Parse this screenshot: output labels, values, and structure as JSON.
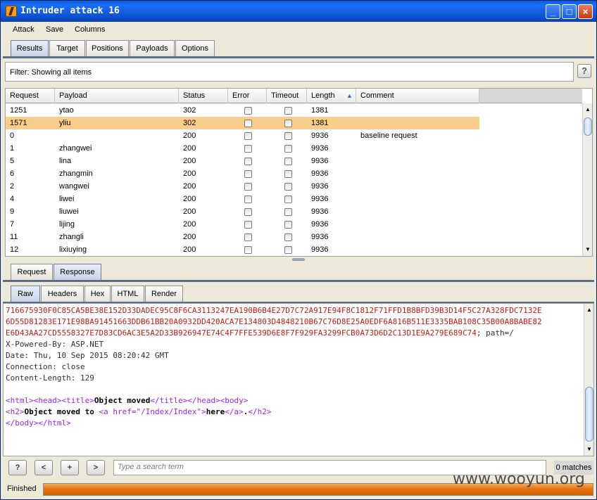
{
  "window": {
    "title": "Intruder attack 16"
  },
  "title_buttons": {
    "minimize": "_",
    "maximize": "□",
    "close": "×"
  },
  "menu": [
    "Attack",
    "Save",
    "Columns"
  ],
  "tabs": [
    "Results",
    "Target",
    "Positions",
    "Payloads",
    "Options"
  ],
  "filter": {
    "text": "Filter:  Showing all items",
    "help": "?"
  },
  "table": {
    "headers": [
      "Request",
      "Payload",
      "Status",
      "Error",
      "Timeout",
      "Length",
      "Comment"
    ],
    "sort_indicator": "▲",
    "rows": [
      {
        "request": "1251",
        "payload": "ytao",
        "status": "302",
        "length": "1381",
        "comment": ""
      },
      {
        "request": "1571",
        "payload": "yliu",
        "status": "302",
        "length": "1381",
        "comment": ""
      },
      {
        "request": "0",
        "payload": "",
        "status": "200",
        "length": "9936",
        "comment": "baseline request"
      },
      {
        "request": "1",
        "payload": "zhangwei",
        "status": "200",
        "length": "9936",
        "comment": ""
      },
      {
        "request": "5",
        "payload": "lina",
        "status": "200",
        "length": "9936",
        "comment": ""
      },
      {
        "request": "6",
        "payload": "zhangmin",
        "status": "200",
        "length": "9936",
        "comment": ""
      },
      {
        "request": "2",
        "payload": "wangwei",
        "status": "200",
        "length": "9936",
        "comment": ""
      },
      {
        "request": "4",
        "payload": "liwei",
        "status": "200",
        "length": "9936",
        "comment": ""
      },
      {
        "request": "9",
        "payload": "liuwei",
        "status": "200",
        "length": "9936",
        "comment": ""
      },
      {
        "request": "7",
        "payload": "lijing",
        "status": "200",
        "length": "9936",
        "comment": ""
      },
      {
        "request": "11",
        "payload": "zhangli",
        "status": "200",
        "length": "9936",
        "comment": ""
      },
      {
        "request": "12",
        "payload": "lixiuying",
        "status": "200",
        "length": "9936",
        "comment": ""
      }
    ]
  },
  "detail_tabs": [
    "Request",
    "Response"
  ],
  "view_tabs": [
    "Raw",
    "Headers",
    "Hex",
    "HTML",
    "Render"
  ],
  "response": {
    "cookie_lines": [
      "716675930F0C85CA5BE38E152D33DADEC95C8F6CA3113247EA190B6B4E27D7C72A917E94F8C1812F71FFD1B8BFD39B3D14F5C27A328FDC7132E",
      "6D55D81283E171E98BA91451663DDB61BB20A0932DD420ACA7E134803D4848210B67C76D8E25A0EDF6A816B511E3335BAB108C35B00A8BABE82",
      "E6D43AA27CD5558327E7D83CD6AC3E5A2D33B926947E74C4F7FFE539D6E8F7F929FA3299FCB0A73D6D2C13D1E9A279E689C74"
    ],
    "cookie_suffix": "; path=/",
    "headers": [
      "X-Powered-By: ASP.NET",
      "Date: Thu, 10 Sep 2015 08:20:42 GMT",
      "Connection: close",
      "Content-Length: 129"
    ],
    "html": {
      "open_html": "<html>",
      "open_head": "<head>",
      "open_title": "<title>",
      "title_text": "Object moved",
      "close_title": "</title>",
      "close_head": "</head>",
      "open_body": "<body>",
      "open_h2": "<h2>",
      "h2_text": "Object moved to ",
      "a_open_start": "<a href=",
      "a_href": "\"/Index/Index\"",
      "a_open_end": ">",
      "a_text": "here",
      "close_a": "</a>",
      "period": ".",
      "close_h2": "</h2>",
      "close_body": "</body>",
      "close_html": "</html>"
    }
  },
  "bottom": {
    "help": "?",
    "prev": "<",
    "add": "+",
    "next": ">",
    "search_placeholder": "Type a search term",
    "matches": "0 matches"
  },
  "status": {
    "text": "Finished",
    "progress": 1.0
  },
  "watermark": "www.wooyun.org"
}
